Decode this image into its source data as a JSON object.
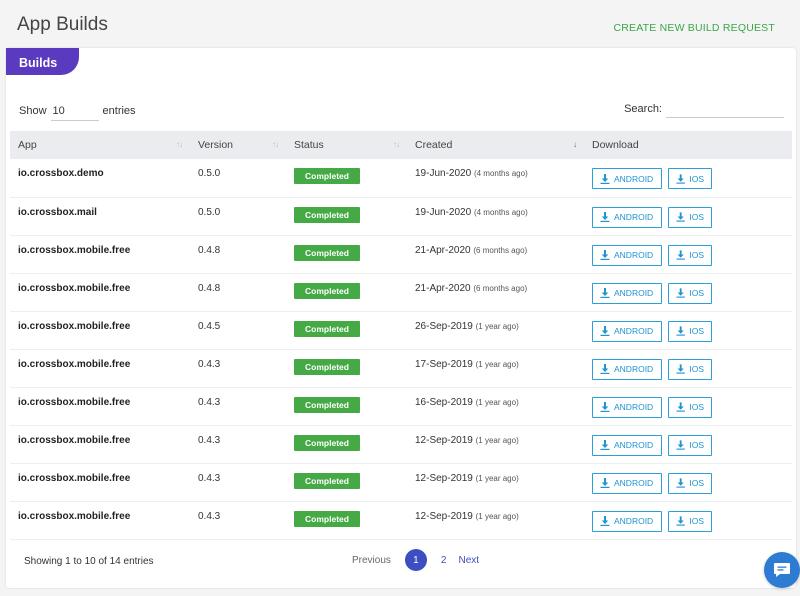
{
  "header": {
    "title": "App Builds",
    "create_label": "CREATE NEW BUILD REQUEST"
  },
  "card": {
    "tab_label": "Builds"
  },
  "controls": {
    "show_label": "Show",
    "entries_value": "10",
    "entries_label": "entries",
    "search_label": "Search:",
    "search_value": ""
  },
  "table": {
    "columns": [
      "App",
      "Version",
      "Status",
      "Created",
      "Download"
    ],
    "rows": [
      {
        "app": "io.crossbox.demo",
        "version": "0.5.0",
        "status": "Completed",
        "created": "19-Jun-2020",
        "ago": "(4 months ago)"
      },
      {
        "app": "io.crossbox.mail",
        "version": "0.5.0",
        "status": "Completed",
        "created": "19-Jun-2020",
        "ago": "(4 months ago)"
      },
      {
        "app": "io.crossbox.mobile.free",
        "version": "0.4.8",
        "status": "Completed",
        "created": "21-Apr-2020",
        "ago": "(6 months ago)"
      },
      {
        "app": "io.crossbox.mobile.free",
        "version": "0.4.8",
        "status": "Completed",
        "created": "21-Apr-2020",
        "ago": "(6 months ago)"
      },
      {
        "app": "io.crossbox.mobile.free",
        "version": "0.4.5",
        "status": "Completed",
        "created": "26-Sep-2019",
        "ago": "(1 year ago)"
      },
      {
        "app": "io.crossbox.mobile.free",
        "version": "0.4.3",
        "status": "Completed",
        "created": "17-Sep-2019",
        "ago": "(1 year ago)"
      },
      {
        "app": "io.crossbox.mobile.free",
        "version": "0.4.3",
        "status": "Completed",
        "created": "16-Sep-2019",
        "ago": "(1 year ago)"
      },
      {
        "app": "io.crossbox.mobile.free",
        "version": "0.4.3",
        "status": "Completed",
        "created": "12-Sep-2019",
        "ago": "(1 year ago)"
      },
      {
        "app": "io.crossbox.mobile.free",
        "version": "0.4.3",
        "status": "Completed",
        "created": "12-Sep-2019",
        "ago": "(1 year ago)"
      },
      {
        "app": "io.crossbox.mobile.free",
        "version": "0.4.3",
        "status": "Completed",
        "created": "12-Sep-2019",
        "ago": "(1 year ago)"
      }
    ],
    "android_label": "ANDROID",
    "ios_label": "IOS"
  },
  "footer": {
    "info": "Showing 1 to 10 of 14 entries",
    "previous_label": "Previous",
    "pages": [
      "1",
      "2"
    ],
    "next_label": "Next"
  },
  "colors": {
    "accent": "#5a3bc0",
    "create_link": "#3aa64a",
    "status_completed": "#45a945",
    "download": "#1f94cf",
    "pager_active": "#3b4fc0",
    "chat": "#2e7bd3"
  },
  "icons": {
    "download": "download-icon",
    "sort": "sort-icon",
    "chat": "chat-bubble-icon"
  }
}
